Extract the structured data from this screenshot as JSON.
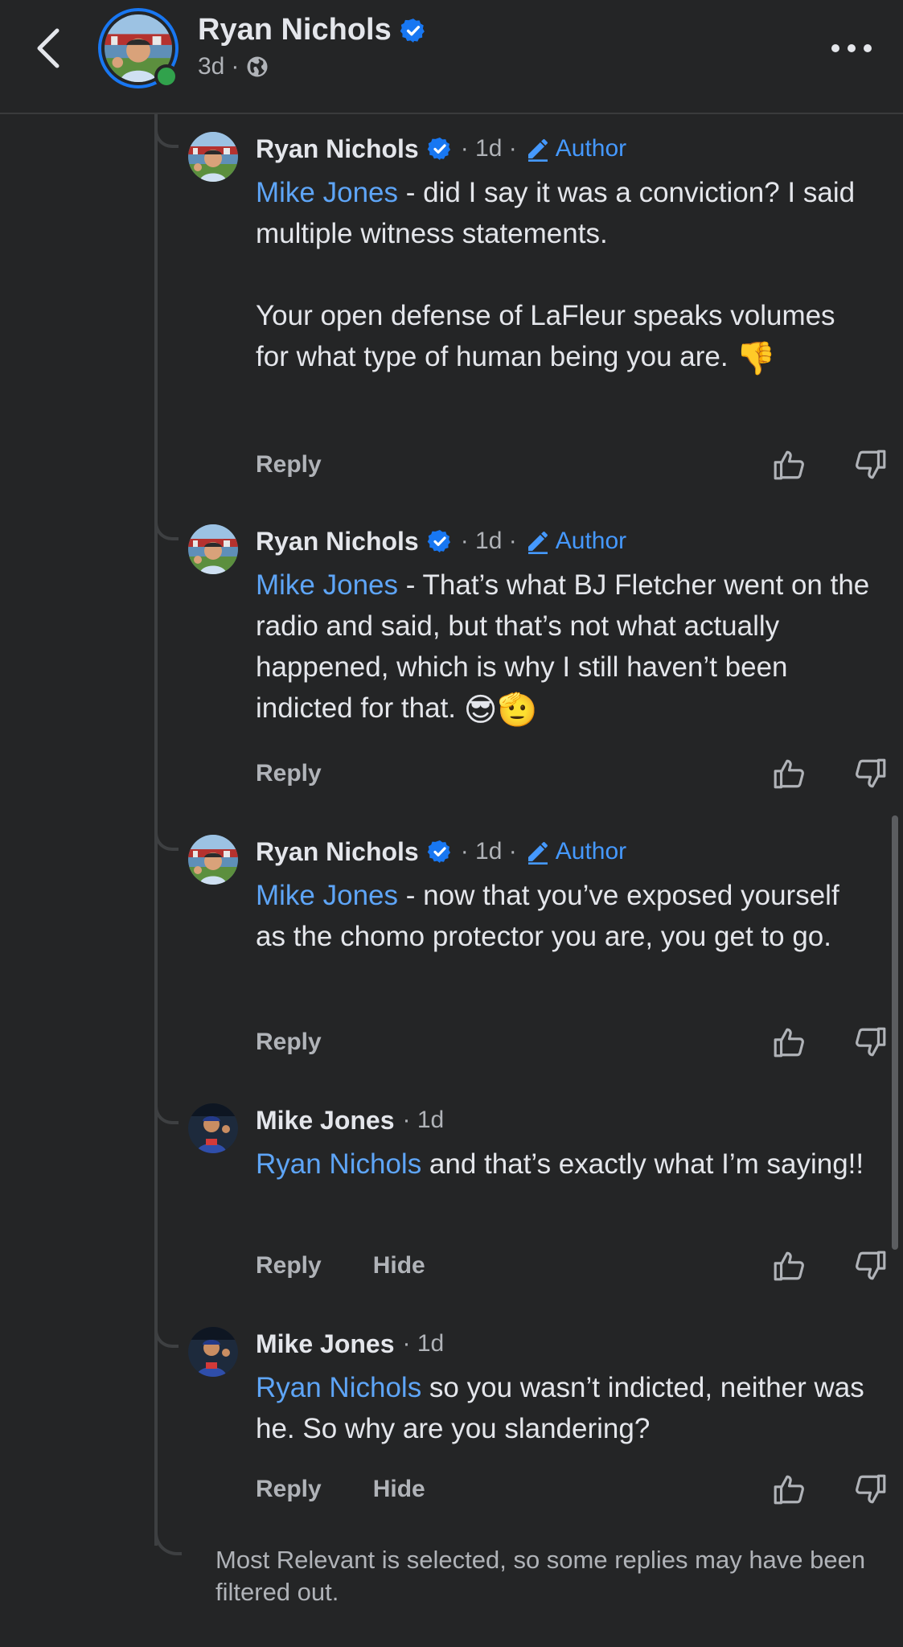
{
  "header": {
    "name": "Ryan Nichols",
    "time": "3d",
    "separator": "·"
  },
  "comments": [
    {
      "name": "Ryan Nichols",
      "time": "· 1d ·",
      "author_label": "Author",
      "mention": "Mike Jones",
      "text": " - did I say it was a conviction? I said multiple witness statements.\n\nYour open defense of LaFleur speaks volumes for what type of human being you are. ",
      "emoji": "👎",
      "reply_label": "Reply"
    },
    {
      "name": "Ryan Nichols",
      "time": "· 1d ·",
      "author_label": "Author",
      "mention": "Mike Jones",
      "text": " - That’s what BJ Fletcher went on the radio and said, but that’s not what actually happened, which is why I still haven’t been indicted for that. ",
      "emoji": "😎🫡",
      "reply_label": "Reply"
    },
    {
      "name": "Ryan Nichols",
      "time": "· 1d ·",
      "author_label": "Author",
      "mention": "Mike Jones",
      "text": " - now that you’ve exposed yourself as the chomo protector you are, you get to go.",
      "reply_label": "Reply"
    },
    {
      "name": "Mike Jones",
      "time": "· 1d",
      "mention": "Ryan Nichols",
      "text": " and that’s exactly what I’m saying!!",
      "reply_label": "Reply",
      "hide_label": "Hide"
    },
    {
      "name": "Mike Jones",
      "time": "· 1d",
      "mention": "Ryan Nichols",
      "text": " so you wasn’t indicted, neither was he. So why are you slandering?",
      "reply_label": "Reply",
      "hide_label": "Hide"
    }
  ],
  "footer_note": "Most Relevant is selected, so some replies may have been filtered out.",
  "colors": {
    "background": "#242526",
    "accent": "#1877f2",
    "mention": "#5ea5f7",
    "online": "#31a24c"
  },
  "icons": {
    "back": "chevron-left-icon",
    "more": "more-horizontal-icon",
    "verified": "verified-badge-icon",
    "globe": "globe-icon",
    "pencil": "pencil-icon",
    "like": "thumbs-up-outline-icon",
    "dislike": "thumbs-down-outline-icon"
  }
}
